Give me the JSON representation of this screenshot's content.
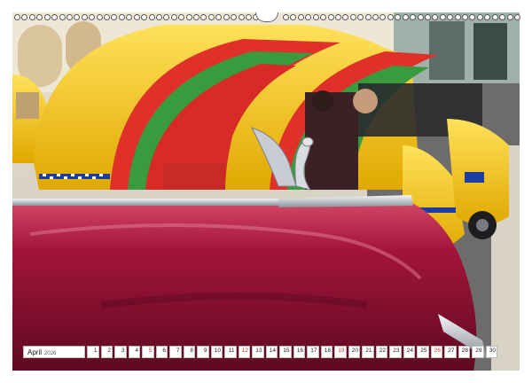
{
  "calendar": {
    "month": "April",
    "year": "2026",
    "days": [
      "1",
      "2",
      "3",
      "4",
      "5",
      "6",
      "7",
      "8",
      "9",
      "10",
      "11",
      "12",
      "13",
      "14",
      "15",
      "16",
      "17",
      "18",
      "19",
      "20",
      "21",
      "22",
      "23",
      "24",
      "25",
      "26",
      "27",
      "28",
      "29",
      "30"
    ],
    "sundays": [
      "5",
      "12",
      "19",
      "26"
    ]
  },
  "colors": {
    "car_red": "#b0163a",
    "coco_yellow": "#f5c414",
    "coco_shell_red": "#e0302a",
    "coco_stripe_green": "#3a9a3e",
    "ornament_silver": "#c9ccd2"
  }
}
